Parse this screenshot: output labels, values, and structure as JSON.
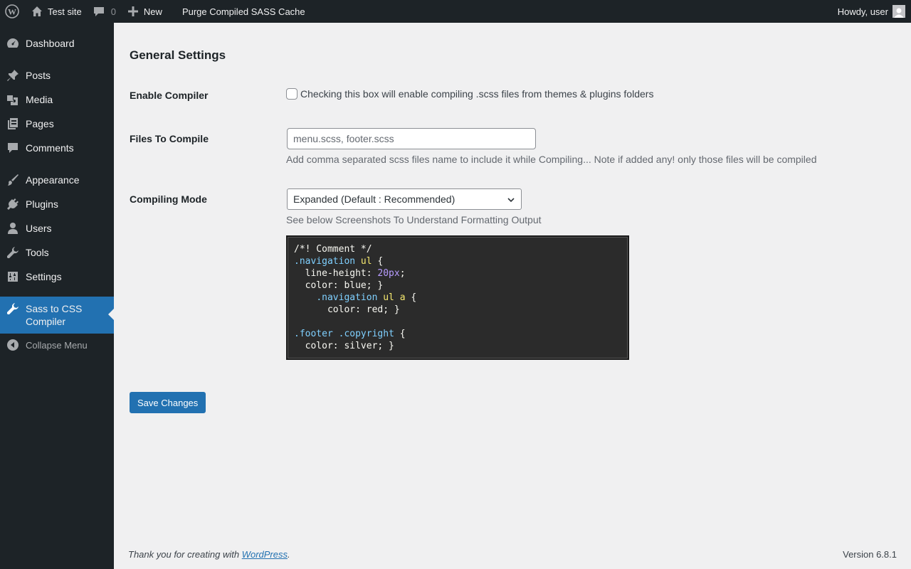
{
  "adminbar": {
    "site_name": "Test site",
    "comments_count": "0",
    "new_label": "New",
    "purge_label": "Purge Compiled SASS Cache",
    "howdy": "Howdy, user"
  },
  "sidebar": {
    "items": [
      {
        "label": "Dashboard",
        "icon": "dashboard-icon"
      },
      {
        "label": "Posts",
        "icon": "pushpin-icon"
      },
      {
        "label": "Media",
        "icon": "media-icon"
      },
      {
        "label": "Pages",
        "icon": "pages-icon"
      },
      {
        "label": "Comments",
        "icon": "comment-icon"
      },
      {
        "label": "Appearance",
        "icon": "brush-icon"
      },
      {
        "label": "Plugins",
        "icon": "plug-icon"
      },
      {
        "label": "Users",
        "icon": "user-icon"
      },
      {
        "label": "Tools",
        "icon": "wrench-icon"
      },
      {
        "label": "Settings",
        "icon": "sliders-icon"
      }
    ],
    "current": {
      "line1": "Sass to CSS",
      "line2": "Compiler",
      "icon": "wrench-icon"
    },
    "collapse_label": "Collapse Menu"
  },
  "main": {
    "title": "General Settings",
    "enable_label": "Enable Compiler",
    "enable_checked": false,
    "enable_desc": "Checking this box will enable compiling .scss files from themes & plugins folders",
    "files_label": "Files To Compile",
    "files_placeholder": "menu.scss, footer.scss",
    "files_value": "",
    "files_desc": "Add comma separated scss files name to include it while Compiling... Note if added any! only those files will be compiled",
    "mode_label": "Compiling Mode",
    "mode_selected": "Expanded (Default : Recommended)",
    "mode_desc": "See below Screenshots To Understand Formatting Output",
    "code_lines": [
      "/*! Comment */",
      ".navigation ul {",
      "  line-height: 20px;",
      "  color: blue; }",
      "    .navigation ul a {",
      "      color: red; }",
      "",
      ".footer .copyright {",
      "  color: silver; }"
    ],
    "save_label": "Save Changes"
  },
  "footer": {
    "thanks_prefix": "Thank you for creating with",
    "thanks_link": "WordPress",
    "thanks_suffix": ".",
    "version": "Version 6.8.1"
  },
  "colors": {
    "adminbar_bg": "#1d2327",
    "accent": "#2271b1",
    "page_bg": "#f0f0f1",
    "code_bg": "#2b2b2b"
  }
}
